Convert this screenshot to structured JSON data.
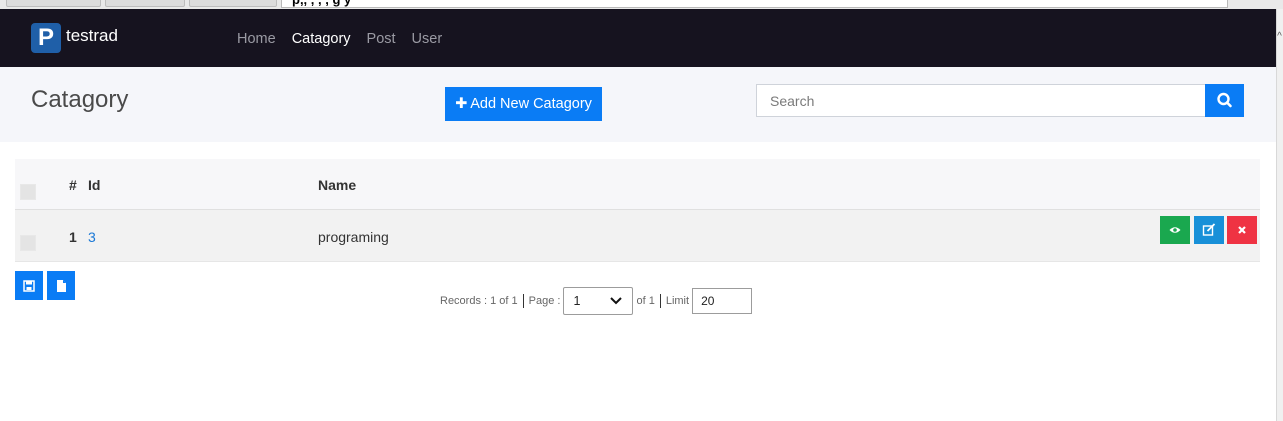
{
  "browser": {
    "url_text": "p,, , ,   , g y"
  },
  "navbar": {
    "brand_logo": "P",
    "brand_name": "testrad",
    "links": [
      {
        "label": "Home",
        "active": false
      },
      {
        "label": "Catagory",
        "active": true
      },
      {
        "label": "Post",
        "active": false
      },
      {
        "label": "User",
        "active": false
      }
    ]
  },
  "header": {
    "title": "Catagory",
    "add_button_label": "Add New Catagory",
    "search_placeholder": "Search"
  },
  "table": {
    "columns": {
      "num": "#",
      "id": "Id",
      "name": "Name"
    },
    "rows": [
      {
        "num": "1",
        "id": "3",
        "name": "programing"
      }
    ]
  },
  "pagination": {
    "records_text": "Records : 1 of 1",
    "page_label": "Page :",
    "page_value": "1",
    "of_text": "of 1",
    "limit_label": "Limit",
    "limit_value": "20"
  },
  "colors": {
    "navbar_bg": "#16131f",
    "primary": "#0a7cf5",
    "view": "#1aa84f",
    "edit": "#1890d8",
    "delete": "#ef3343"
  }
}
